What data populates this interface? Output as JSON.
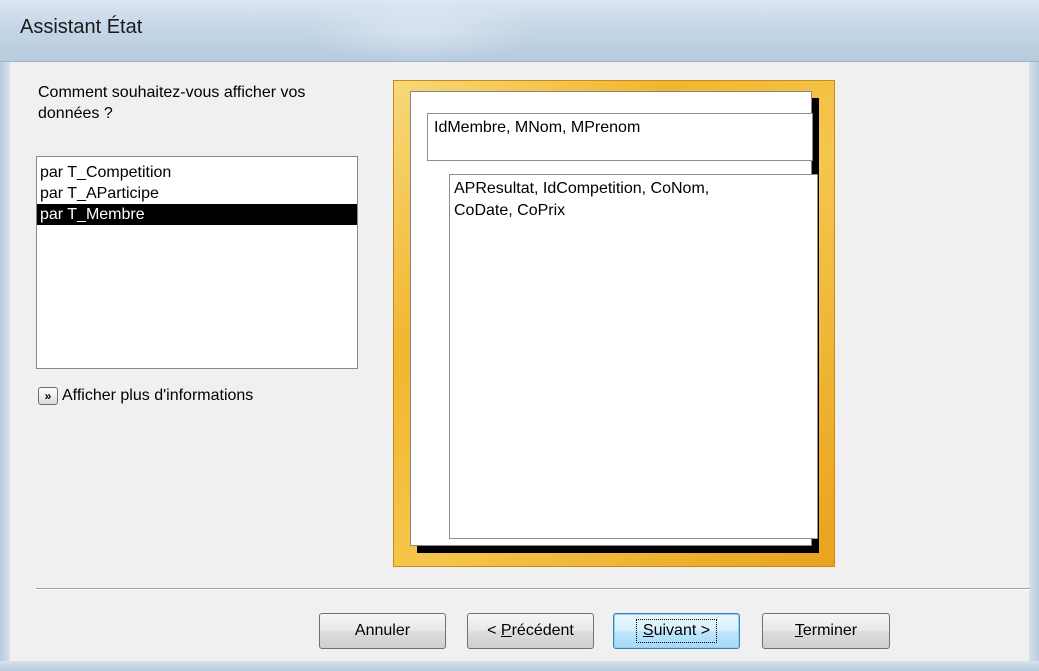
{
  "window": {
    "title": "Assistant État"
  },
  "question": {
    "text": "Comment souhaitez-vous afficher vos données ?"
  },
  "list": {
    "items": [
      {
        "label": "par T_Competition",
        "selected": false
      },
      {
        "label": "par T_AParticipe",
        "selected": false
      },
      {
        "label": "par T_Membre",
        "selected": true
      }
    ]
  },
  "more_info": {
    "icon": "double-chevron-right-icon",
    "glyph": "»",
    "label": "Afficher plus d'informations"
  },
  "preview": {
    "group_fields": "IdMembre, MNom, MPrenom",
    "detail_fields_line1": "APResultat, IdCompetition, CoNom,",
    "detail_fields_line2": "CoDate, CoPrix",
    "colors": {
      "frame": "#f2b62f",
      "page": "#ffffff"
    }
  },
  "buttons": {
    "cancel": {
      "label": "Annuler"
    },
    "previous": {
      "prefix": "< ",
      "mnemonic": "P",
      "rest": "récédent"
    },
    "next": {
      "mnemonic": "S",
      "rest": "uivant >"
    },
    "finish": {
      "mnemonic": "T",
      "rest": "erminer"
    }
  }
}
